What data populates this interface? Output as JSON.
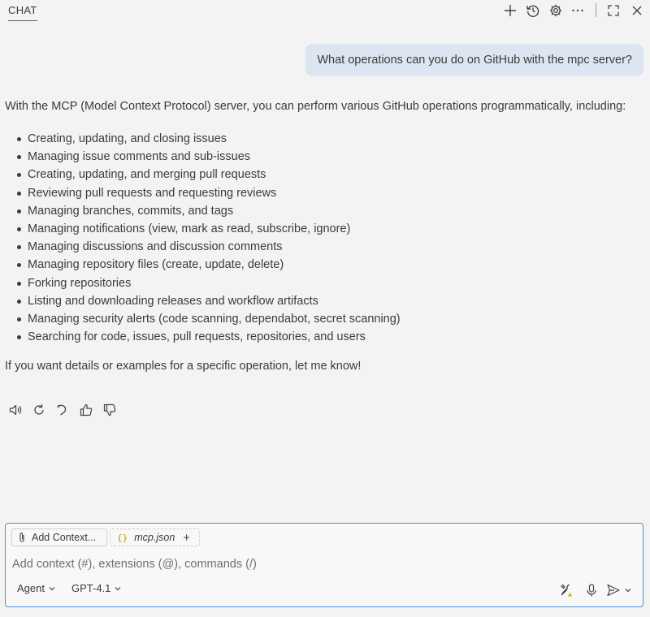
{
  "header": {
    "tab_label": "CHAT",
    "icons": [
      "plus-icon",
      "history-icon",
      "gear-icon",
      "more-icon",
      "maximize-icon",
      "close-icon"
    ]
  },
  "conversation": {
    "user_message": "What operations can you do on GitHub with the mpc server?",
    "response_intro": "With the MCP (Model Context Protocol) server, you can perform various GitHub operations programmatically, including:",
    "response_items": [
      "Creating, updating, and closing issues",
      "Managing issue comments and sub-issues",
      "Creating, updating, and merging pull requests",
      "Reviewing pull requests and requesting reviews",
      "Managing branches, commits, and tags",
      "Managing notifications (view, mark as read, subscribe, ignore)",
      "Managing discussions and discussion comments",
      "Managing repository files (create, update, delete)",
      "Forking repositories",
      "Listing and downloading releases and workflow artifacts",
      "Managing security alerts (code scanning, dependabot, secret scanning)",
      "Searching for code, issues, pull requests, repositories, and users"
    ],
    "response_outro": "If you want details or examples for a specific operation, let me know!",
    "action_icons": [
      "speaker-icon",
      "retry-icon",
      "undo-icon",
      "thumbs-up-icon",
      "thumbs-down-icon"
    ]
  },
  "composer": {
    "add_context_label": "Add Context...",
    "attached_file": "mcp.json",
    "file_icon_glyph": "{}",
    "placeholder": "Add context (#), extensions (@), commands (/)",
    "value": "",
    "mode_label": "Agent",
    "model_label": "GPT-4.1",
    "accent_color": "#4c8fdd",
    "warning_color": "#e8a600"
  }
}
